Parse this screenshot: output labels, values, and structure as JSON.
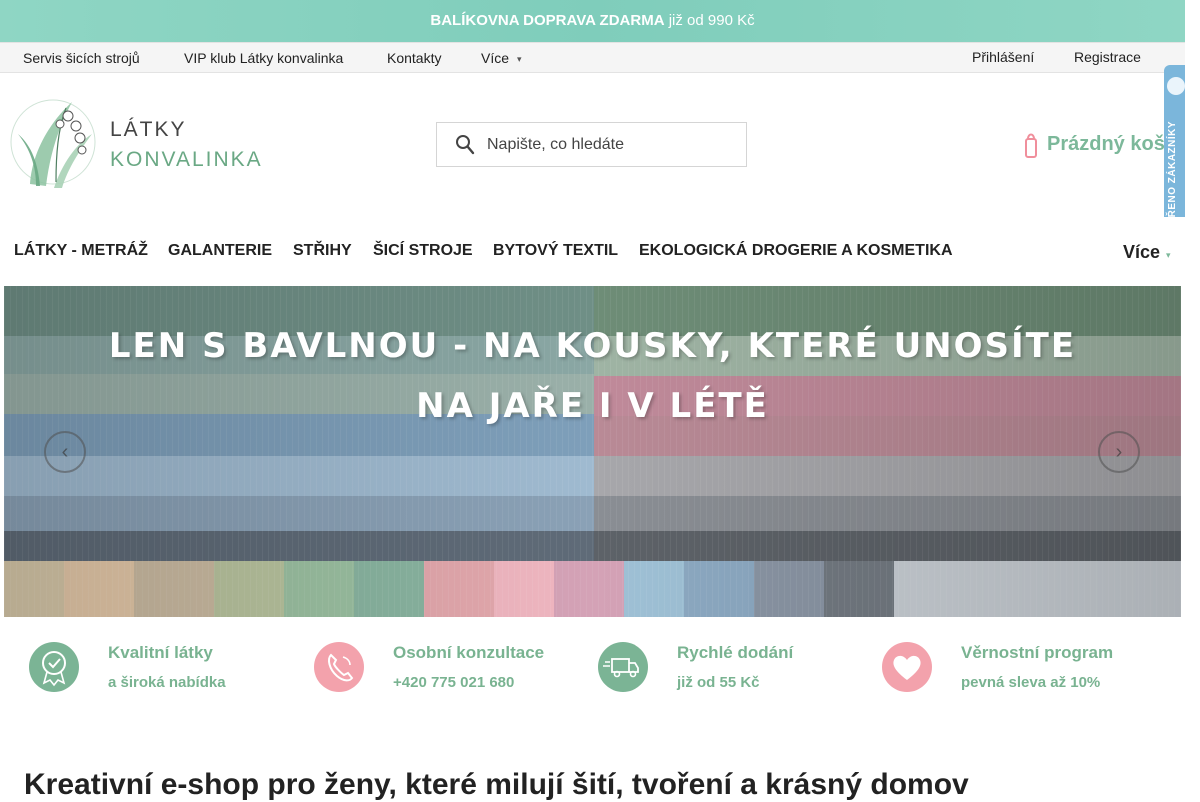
{
  "promo": {
    "bold": "BALÍKOVNA DOPRAVA ZDARMA",
    "light": "již od 990 Kč"
  },
  "subnav": {
    "items": [
      "Servis šicích strojů",
      "VIP klub Látky konvalinka",
      "Kontakty",
      "Více"
    ],
    "login": "Přihlášení",
    "register": "Registrace"
  },
  "logo": {
    "line1": "LÁTKY",
    "line2": "KONVALINKA"
  },
  "search": {
    "placeholder": "Napište, co hledáte"
  },
  "cart": {
    "label": "Prázdný koš"
  },
  "badge": {
    "text": "OVĚŘENO ZÁKAZNÍKY"
  },
  "mainnav": {
    "items": [
      "LÁTKY - METRÁŽ",
      "GALANTERIE",
      "STŘIHY",
      "ŠICÍ STROJE",
      "BYTOVÝ TEXTIL",
      "EKOLOGICKÁ DROGERIE A KOSMETIKA"
    ],
    "more": "Více"
  },
  "banner": {
    "line1": "LEN S BAVLNOU - NA KOUSKY, KTERÉ UNOSÍTE",
    "line2": "NA JAŘE I V LÉTĚ"
  },
  "features": [
    {
      "title": "Kvalitní látky",
      "sub": "a široká nabídka",
      "icon": "quality-badge-icon"
    },
    {
      "title": "Osobní konzultace",
      "sub": "+420 775 021 680",
      "icon": "phone-icon"
    },
    {
      "title": "Rychlé dodání",
      "sub": "již od 55 Kč",
      "icon": "delivery-truck-icon"
    },
    {
      "title": "Věrnostní program",
      "sub": "pevná sleva až 10%",
      "icon": "heart-icon"
    }
  ],
  "page_title": "Kreativní e-shop pro ženy, které milují šití, tvoření a krásný domov",
  "colors": {
    "accent": "#79b391",
    "promo": "#8fd3c3",
    "pink": "#f08f9c"
  }
}
